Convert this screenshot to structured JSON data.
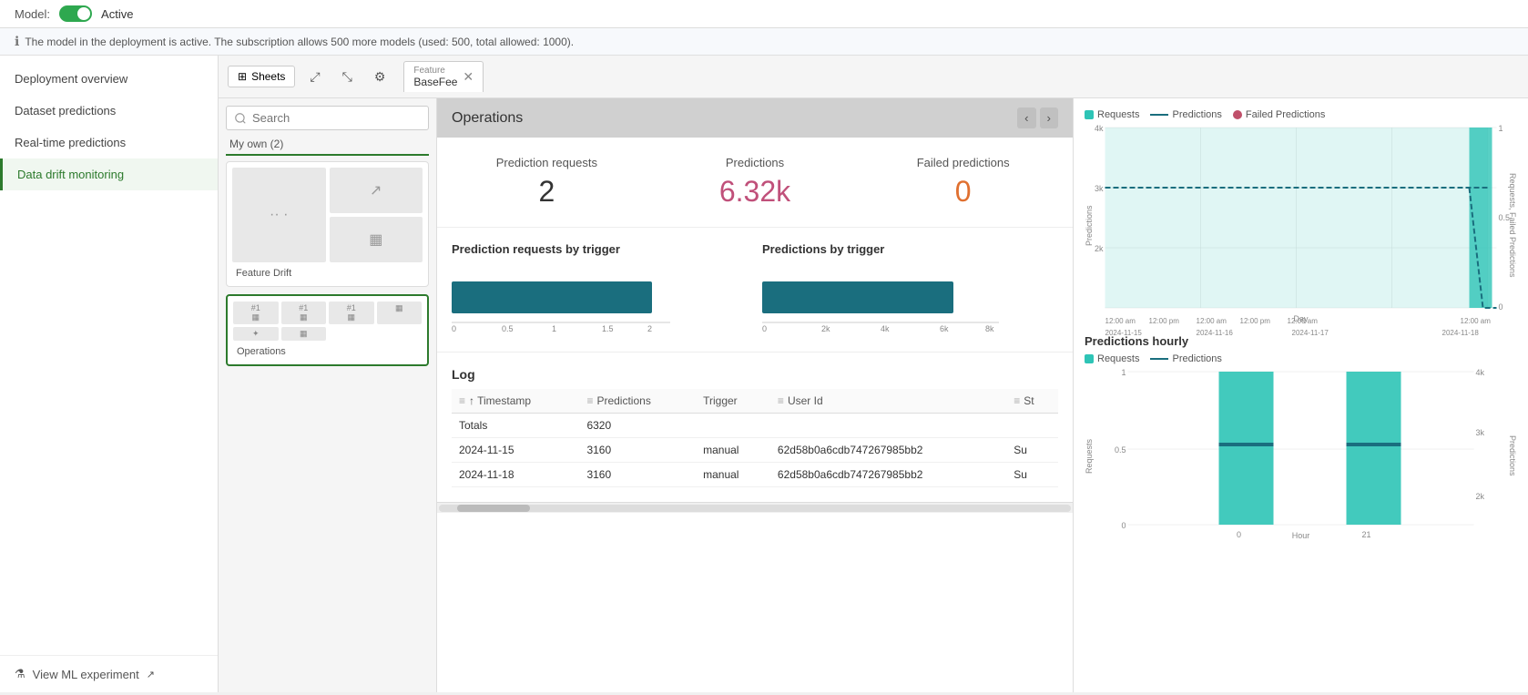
{
  "topBar": {
    "modelLabel": "Model:",
    "activeLabel": "Active"
  },
  "infoBar": {
    "message": "The model in the deployment is active. The subscription allows 500 more models (used: 500, total allowed: 1000)."
  },
  "sidebar": {
    "items": [
      {
        "label": "Deployment overview",
        "active": false
      },
      {
        "label": "Dataset predictions",
        "active": false
      },
      {
        "label": "Real-time predictions",
        "active": false
      },
      {
        "label": "Data drift monitoring",
        "active": true
      }
    ],
    "viewMLExperiment": "View ML experiment"
  },
  "toolbar": {
    "sheetsLabel": "Sheets",
    "tabFeature": "Feature",
    "tabValue": "BaseFee"
  },
  "leftPanel": {
    "searchPlaceholder": "Search",
    "sectionLabel": "My own (2)",
    "cards": [
      {
        "name": "Feature Drift",
        "active": false
      },
      {
        "name": "Operations",
        "active": true
      }
    ]
  },
  "mainPanel": {
    "title": "Operations",
    "stats": {
      "predictionRequests": {
        "label": "Prediction requests",
        "value": "2"
      },
      "predictions": {
        "label": "Predictions",
        "value": "6.32k"
      },
      "failedPredictions": {
        "label": "Failed predictions",
        "value": "0"
      }
    },
    "charts": {
      "byTriggerRequests": {
        "title": "Prediction requests by trigger",
        "barWidth": 100,
        "axisLabels": [
          "0",
          "0.5",
          "1",
          "1.5",
          "2"
        ],
        "barValue": 2
      },
      "byTriggerPredictions": {
        "title": "Predictions by trigger",
        "axisLabels": [
          "0",
          "2k",
          "4k",
          "6k",
          "8k"
        ],
        "barValue": 6320
      }
    },
    "log": {
      "title": "Log",
      "columns": [
        "Timestamp",
        "Predictions",
        "Trigger",
        "User Id",
        "St"
      ],
      "totalsLabel": "Totals",
      "totalsValue": "6320",
      "rows": [
        {
          "timestamp": "2024-11-15",
          "predictions": "3160",
          "trigger": "manual",
          "userId": "62d58b0a6cdb747267985bb2",
          "status": "Su"
        },
        {
          "timestamp": "2024-11-18",
          "predictions": "3160",
          "trigger": "manual",
          "userId": "62d58b0a6cdb747267985bb2",
          "status": "Su"
        }
      ]
    }
  },
  "rightPanel": {
    "topChart": {
      "title": "",
      "legend": [
        {
          "label": "Requests",
          "type": "box",
          "color": "#2ec4b6"
        },
        {
          "label": "Predictions",
          "type": "line",
          "color": "#1a6e7e"
        },
        {
          "label": "Failed Predictions",
          "type": "dot",
          "color": "#c0506a"
        }
      ],
      "yAxisLeft": [
        "4k",
        "3k",
        "2k"
      ],
      "yAxisRight": [
        "1",
        "0.5",
        "0"
      ],
      "xLabels": [
        "12:00 am",
        "12:00 pm",
        "12:00 am",
        "12:00 pm",
        "12:00 am",
        "12:00 am"
      ],
      "dateLabels": [
        "2024-11-15",
        "2024-11-16",
        "2024-11-17",
        "2024-11-18"
      ],
      "xAxisTitle": "Day",
      "yAxisLeftTitle": "Predictions",
      "yAxisRightTitle": "Requests, Failed Predictions"
    },
    "bottomChart": {
      "title": "Predictions hourly",
      "legend": [
        {
          "label": "Requests",
          "type": "box",
          "color": "#2ec4b6"
        },
        {
          "label": "Predictions",
          "type": "line",
          "color": "#1a6e7e"
        }
      ],
      "yAxisLeft": [
        "1",
        "0.5",
        "0"
      ],
      "yAxisRight": [
        "4k",
        "3k",
        "2k"
      ],
      "xLabels": [
        "0",
        "21"
      ],
      "xAxisTitle": "Hour",
      "yAxisLeftTitle": "Requests",
      "yAxisRightTitle": "Predictions"
    }
  }
}
